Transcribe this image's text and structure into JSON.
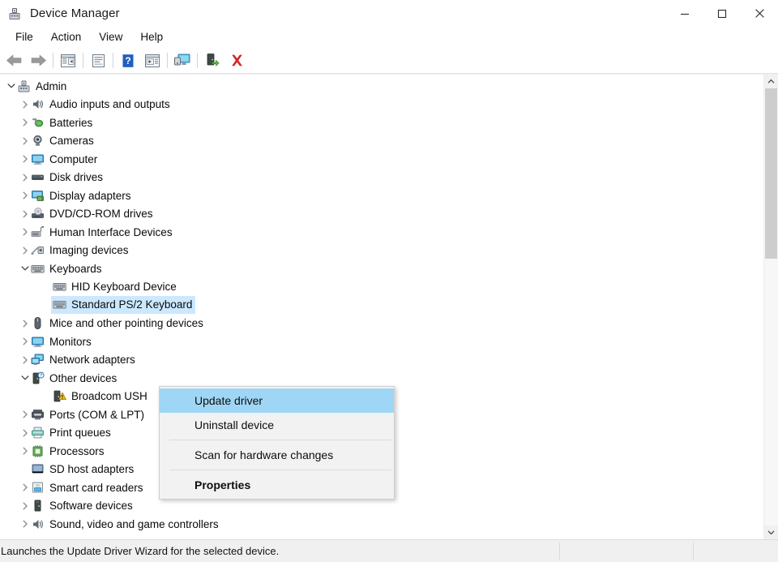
{
  "window": {
    "title": "Device Manager",
    "icon": "device-manager-icon",
    "controls": {
      "minimize": "Minimize",
      "maximize": "Maximize",
      "close": "Close"
    }
  },
  "menubar": {
    "items": [
      {
        "label": "File"
      },
      {
        "label": "Action"
      },
      {
        "label": "View"
      },
      {
        "label": "Help"
      }
    ]
  },
  "toolbar": {
    "buttons": [
      {
        "name": "back-button",
        "icon": "left-arrow-icon"
      },
      {
        "name": "forward-button",
        "icon": "right-arrow-icon"
      },
      {
        "name": "separator-1",
        "icon": "separator"
      },
      {
        "name": "show-hide-console-tree-button",
        "icon": "console-tree-icon"
      },
      {
        "name": "separator-2",
        "icon": "separator"
      },
      {
        "name": "properties-button",
        "icon": "properties-page-icon"
      },
      {
        "name": "separator-3",
        "icon": "separator"
      },
      {
        "name": "help-button",
        "icon": "question-mark-icon"
      },
      {
        "name": "show-hide-action-pane-button",
        "icon": "action-pane-icon"
      },
      {
        "name": "separator-4",
        "icon": "separator"
      },
      {
        "name": "scan-for-hardware-changes-button",
        "icon": "scan-monitor-icon"
      },
      {
        "name": "separator-5",
        "icon": "separator"
      },
      {
        "name": "update-driver-button",
        "icon": "update-driver-icon"
      },
      {
        "name": "uninstall-device-button",
        "icon": "red-x-icon"
      }
    ]
  },
  "tree": {
    "nodes": [
      {
        "label": "Admin",
        "depth": 0,
        "expander": "expanded",
        "icon": "computer-node-icon",
        "selected": false
      },
      {
        "label": "Audio inputs and outputs",
        "depth": 1,
        "expander": "collapsed",
        "icon": "speaker-icon",
        "selected": false
      },
      {
        "label": "Batteries",
        "depth": 1,
        "expander": "collapsed",
        "icon": "battery-icon",
        "selected": false
      },
      {
        "label": "Cameras",
        "depth": 1,
        "expander": "collapsed",
        "icon": "camera-icon",
        "selected": false
      },
      {
        "label": "Computer",
        "depth": 1,
        "expander": "collapsed",
        "icon": "monitor-icon",
        "selected": false
      },
      {
        "label": "Disk drives",
        "depth": 1,
        "expander": "collapsed",
        "icon": "disk-drive-icon",
        "selected": false
      },
      {
        "label": "Display adapters",
        "depth": 1,
        "expander": "collapsed",
        "icon": "display-adapter-icon",
        "selected": false
      },
      {
        "label": "DVD/CD-ROM drives",
        "depth": 1,
        "expander": "collapsed",
        "icon": "dvd-drive-icon",
        "selected": false
      },
      {
        "label": "Human Interface Devices",
        "depth": 1,
        "expander": "collapsed",
        "icon": "hid-icon",
        "selected": false
      },
      {
        "label": "Imaging devices",
        "depth": 1,
        "expander": "collapsed",
        "icon": "imaging-device-icon",
        "selected": false
      },
      {
        "label": "Keyboards",
        "depth": 1,
        "expander": "expanded",
        "icon": "keyboard-icon",
        "selected": false
      },
      {
        "label": "HID Keyboard Device",
        "depth": 2,
        "expander": "none",
        "icon": "keyboard-icon",
        "selected": false
      },
      {
        "label": "Standard PS/2 Keyboard",
        "depth": 2,
        "expander": "none",
        "icon": "keyboard-icon",
        "selected": true
      },
      {
        "label": "Mice and other pointing devices",
        "depth": 1,
        "expander": "collapsed",
        "icon": "mouse-icon",
        "selected": false
      },
      {
        "label": "Monitors",
        "depth": 1,
        "expander": "collapsed",
        "icon": "monitor-icon",
        "selected": false
      },
      {
        "label": "Network adapters",
        "depth": 1,
        "expander": "collapsed",
        "icon": "network-adapter-icon",
        "selected": false
      },
      {
        "label": "Other devices",
        "depth": 1,
        "expander": "expanded",
        "icon": "other-device-icon",
        "selected": false
      },
      {
        "label": "Broadcom USH",
        "depth": 2,
        "expander": "none",
        "icon": "unknown-device-warning-icon",
        "selected": false
      },
      {
        "label": "Ports (COM & LPT)",
        "depth": 1,
        "expander": "collapsed",
        "icon": "port-icon",
        "selected": false
      },
      {
        "label": "Print queues",
        "depth": 1,
        "expander": "collapsed",
        "icon": "printer-icon",
        "selected": false
      },
      {
        "label": "Processors",
        "depth": 1,
        "expander": "collapsed",
        "icon": "processor-icon",
        "selected": false
      },
      {
        "label": "SD host adapters",
        "depth": 1,
        "expander": "none",
        "icon": "sd-host-adapter-icon",
        "selected": false
      },
      {
        "label": "Smart card readers",
        "depth": 1,
        "expander": "collapsed",
        "icon": "smart-card-reader-icon",
        "selected": false
      },
      {
        "label": "Software devices",
        "depth": 1,
        "expander": "collapsed",
        "icon": "software-device-icon",
        "selected": false
      },
      {
        "label": "Sound, video and game controllers",
        "depth": 1,
        "expander": "collapsed",
        "icon": "speaker-icon",
        "selected": false
      }
    ]
  },
  "context_menu": {
    "items": [
      {
        "label": "Update driver",
        "highlighted": true,
        "bold": false
      },
      {
        "label": "Uninstall device",
        "highlighted": false,
        "bold": false
      },
      {
        "separator": true
      },
      {
        "label": "Scan for hardware changes",
        "highlighted": false,
        "bold": false
      },
      {
        "separator": true
      },
      {
        "label": "Properties",
        "highlighted": false,
        "bold": true
      }
    ]
  },
  "statusbar": {
    "text": "Launches the Update Driver Wizard for the selected device."
  },
  "colors": {
    "selection": "#cce8ff",
    "menu_highlight": "#9fd6f5",
    "status_bg": "#f0f0f0",
    "accent_red": "#d4252a",
    "accent_green": "#4a8b3b"
  }
}
